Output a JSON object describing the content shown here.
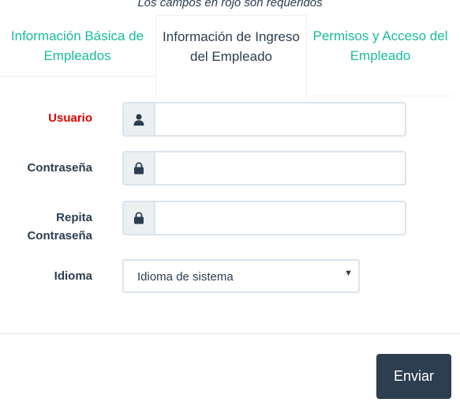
{
  "form": {
    "required_note": "Los campos en rojo son requeridos",
    "tabs": [
      {
        "label": "Información Básica de Empleados",
        "active": false
      },
      {
        "label": "Información de Ingreso del Empleado",
        "active": true
      },
      {
        "label": "Permisos y Acceso del Empleado",
        "active": false
      }
    ],
    "fields": {
      "usuario": {
        "label": "Usuario",
        "value": "",
        "icon": "user-icon",
        "required": true
      },
      "contrasena": {
        "label": "Contraseña",
        "value": "",
        "icon": "lock-icon"
      },
      "repita": {
        "label_line1": "Repita",
        "label_line2": "Contraseña",
        "value": "",
        "icon": "lock-icon"
      },
      "idioma": {
        "label": "Idioma",
        "selected": "Idioma de sistema"
      }
    },
    "submit_label": "Enviar"
  },
  "colors": {
    "accent": "#18bc9c",
    "text": "#2c3e50",
    "required": "#e00000",
    "button_bg": "#2c3e50",
    "addon_bg": "#ecf0f1",
    "border": "#dce4ec"
  }
}
